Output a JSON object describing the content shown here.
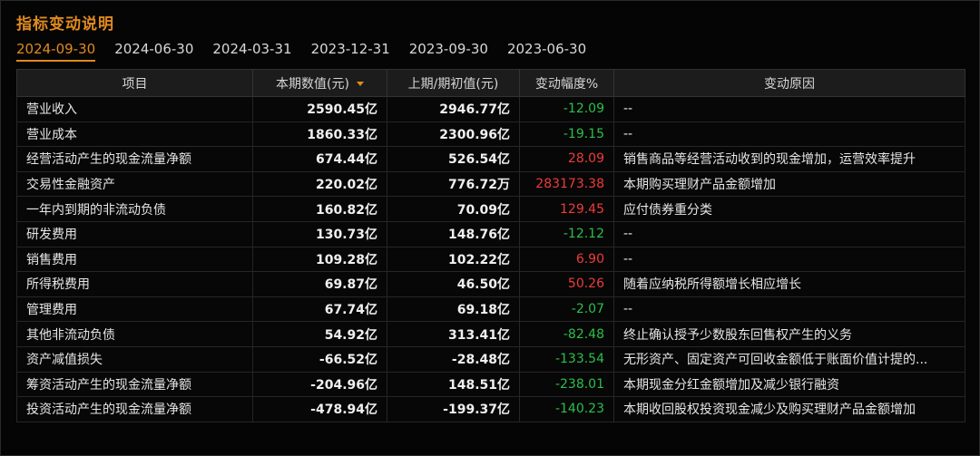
{
  "title": "指标变动说明",
  "tabs": [
    "2024-09-30",
    "2024-06-30",
    "2024-03-31",
    "2023-12-31",
    "2023-09-30",
    "2023-06-30"
  ],
  "active_tab": 0,
  "headers": {
    "item": "项目",
    "current": "本期数值(元)",
    "previous": "上期/期初值(元)",
    "change": "变动幅度%",
    "reason": "变动原因"
  },
  "sort_icon": "sort-down-icon",
  "colors": {
    "accent": "#e08a1e",
    "up": "#ee3b3b",
    "down": "#2bbf4a"
  },
  "rows": [
    {
      "item": "营业收入",
      "current": "2590.45亿",
      "previous": "2946.77亿",
      "change": "-12.09",
      "reason": "--"
    },
    {
      "item": "营业成本",
      "current": "1860.33亿",
      "previous": "2300.96亿",
      "change": "-19.15",
      "reason": "--"
    },
    {
      "item": "经营活动产生的现金流量净额",
      "current": "674.44亿",
      "previous": "526.54亿",
      "change": "28.09",
      "reason": "销售商品等经营活动收到的现金增加，运营效率提升"
    },
    {
      "item": "交易性金融资产",
      "current": "220.02亿",
      "previous": "776.72万",
      "change": "283173.38",
      "reason": "本期购买理财产品金额增加"
    },
    {
      "item": "一年内到期的非流动负债",
      "current": "160.82亿",
      "previous": "70.09亿",
      "change": "129.45",
      "reason": "应付债券重分类"
    },
    {
      "item": "研发费用",
      "current": "130.73亿",
      "previous": "148.76亿",
      "change": "-12.12",
      "reason": "--"
    },
    {
      "item": "销售费用",
      "current": "109.28亿",
      "previous": "102.22亿",
      "change": "6.90",
      "reason": "--"
    },
    {
      "item": "所得税费用",
      "current": "69.87亿",
      "previous": "46.50亿",
      "change": "50.26",
      "reason": "随着应纳税所得额增长相应增长"
    },
    {
      "item": "管理费用",
      "current": "67.74亿",
      "previous": "69.18亿",
      "change": "-2.07",
      "reason": "--"
    },
    {
      "item": "其他非流动负债",
      "current": "54.92亿",
      "previous": "313.41亿",
      "change": "-82.48",
      "reason": "终止确认授予少数股东回售权产生的义务"
    },
    {
      "item": "资产减值损失",
      "current": "-66.52亿",
      "previous": "-28.48亿",
      "change": "-133.54",
      "reason": "无形资产、固定资产可回收金额低于账面价值计提的..."
    },
    {
      "item": "筹资活动产生的现金流量净额",
      "current": "-204.96亿",
      "previous": "148.51亿",
      "change": "-238.01",
      "reason": "本期现金分红金额增加及减少银行融资"
    },
    {
      "item": "投资活动产生的现金流量净额",
      "current": "-478.94亿",
      "previous": "-199.37亿",
      "change": "-140.23",
      "reason": "本期收回股权投资现金减少及购买理财产品金额增加"
    }
  ]
}
